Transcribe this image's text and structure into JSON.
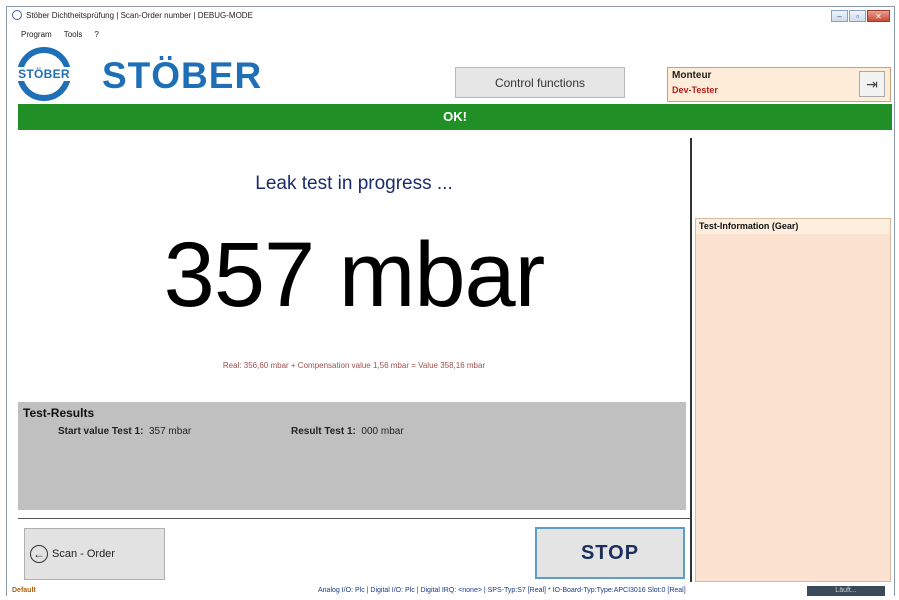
{
  "window": {
    "title": "Stöber Dichtheitsprüfung | Scan-Order number | DEBUG-MODE",
    "min_label": "–",
    "max_label": "▫",
    "close_label": "✕"
  },
  "menu": [
    "Program",
    "Tools",
    "?"
  ],
  "logo": {
    "mark_text": "STÖBER",
    "brand_text": "STÖBER",
    "color": "#1f6fb7"
  },
  "header": {
    "control_functions_label": "Control functions",
    "user_label": "Monteur",
    "user_value": "Dev-Tester",
    "logout_icon": "⇥"
  },
  "status_banner": {
    "text": "OK!",
    "color": "#1f8f26"
  },
  "main": {
    "progress_text": "Leak test in progress ...",
    "big_value": "357 mbar",
    "real_line": "Real: 356,60 mbar + Compensation value 1,56 mbar = Value 358,16 mbar"
  },
  "results": {
    "title": "Test-Results",
    "start_label": "Start value Test 1:",
    "start_value": "357 mbar",
    "result_label": "Result Test 1:",
    "result_value": "000 mbar"
  },
  "buttons": {
    "scan_label": "Scan - Order",
    "scan_icon": "←",
    "stop_label": "STOP"
  },
  "test_info": {
    "title": "Test-Information (Gear)"
  },
  "statusbar": {
    "left": "Default",
    "middle": "Analog I/O: Plc  |  Digital I/O: Plc  |  Digital IRQ: <none>  |  SPS-Typ:S7 [Real] * IO-Board-Typ:Type:APCI3016 Slot:0 [Real]",
    "running": "Läuft..."
  }
}
